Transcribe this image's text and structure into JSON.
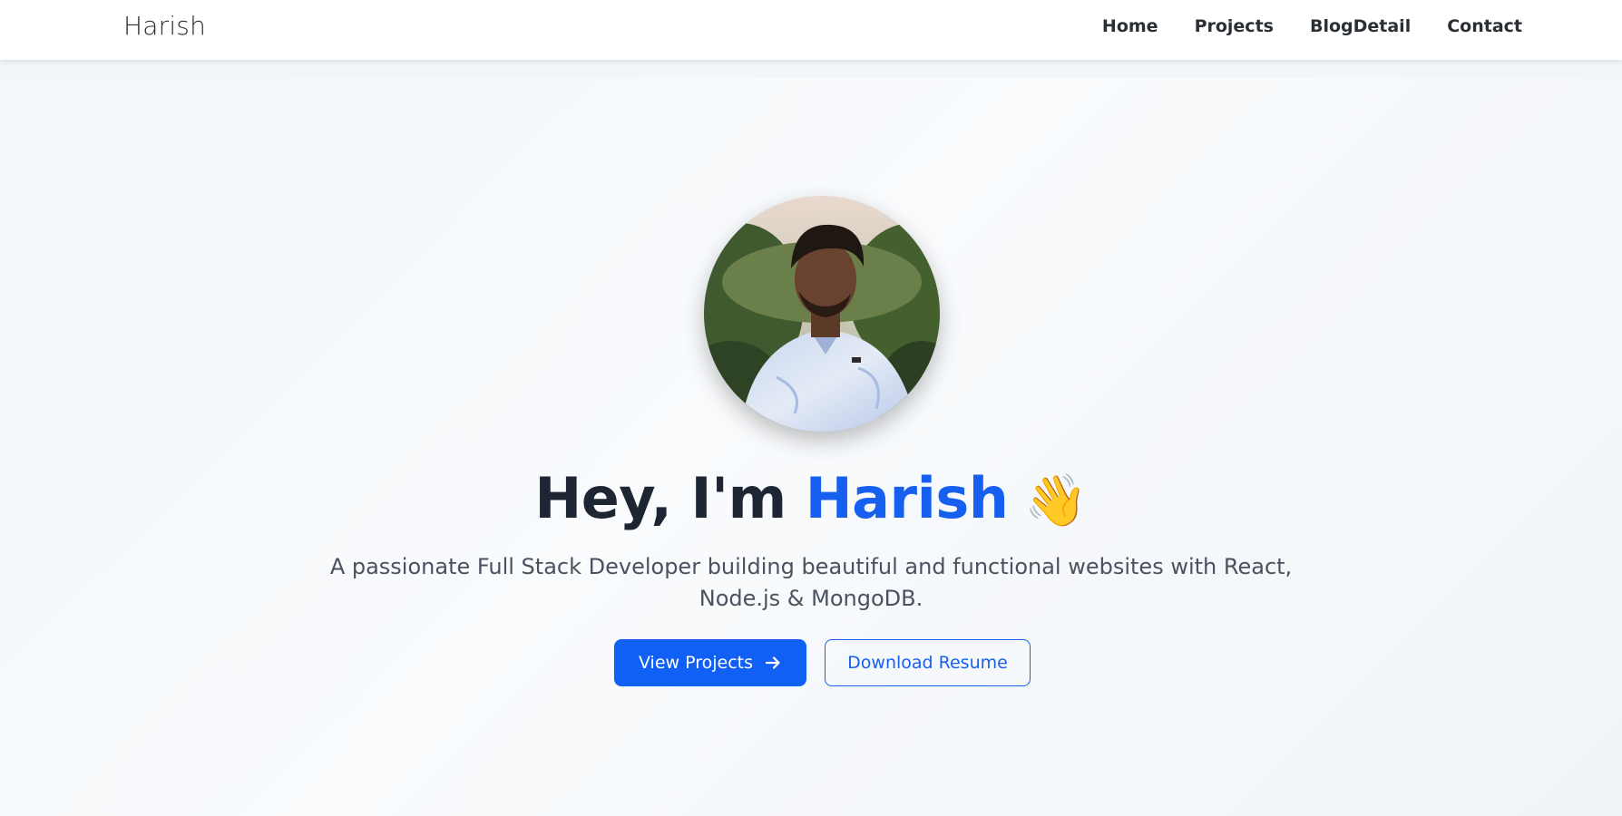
{
  "navbar": {
    "brand": "Harish",
    "links": [
      {
        "label": "Home"
      },
      {
        "label": "Projects"
      },
      {
        "label": "BlogDetail"
      },
      {
        "label": "Contact"
      }
    ]
  },
  "hero": {
    "avatar_icon": "profile-photo",
    "headline_prefix": "Hey, I'm ",
    "headline_name": "Harish",
    "wave_emoji": "👋",
    "subtitle": "A passionate Full Stack Developer building beautiful and functional websites with React, Node.js & MongoDB.",
    "primary_button": {
      "label": "View Projects",
      "icon": "arrow-right-icon"
    },
    "secondary_button": {
      "label": "Download Resume"
    }
  },
  "colors": {
    "accent": "#1760ef",
    "heading": "#1e2633",
    "body_text": "#4a5260",
    "background": "#f3f6f9"
  }
}
